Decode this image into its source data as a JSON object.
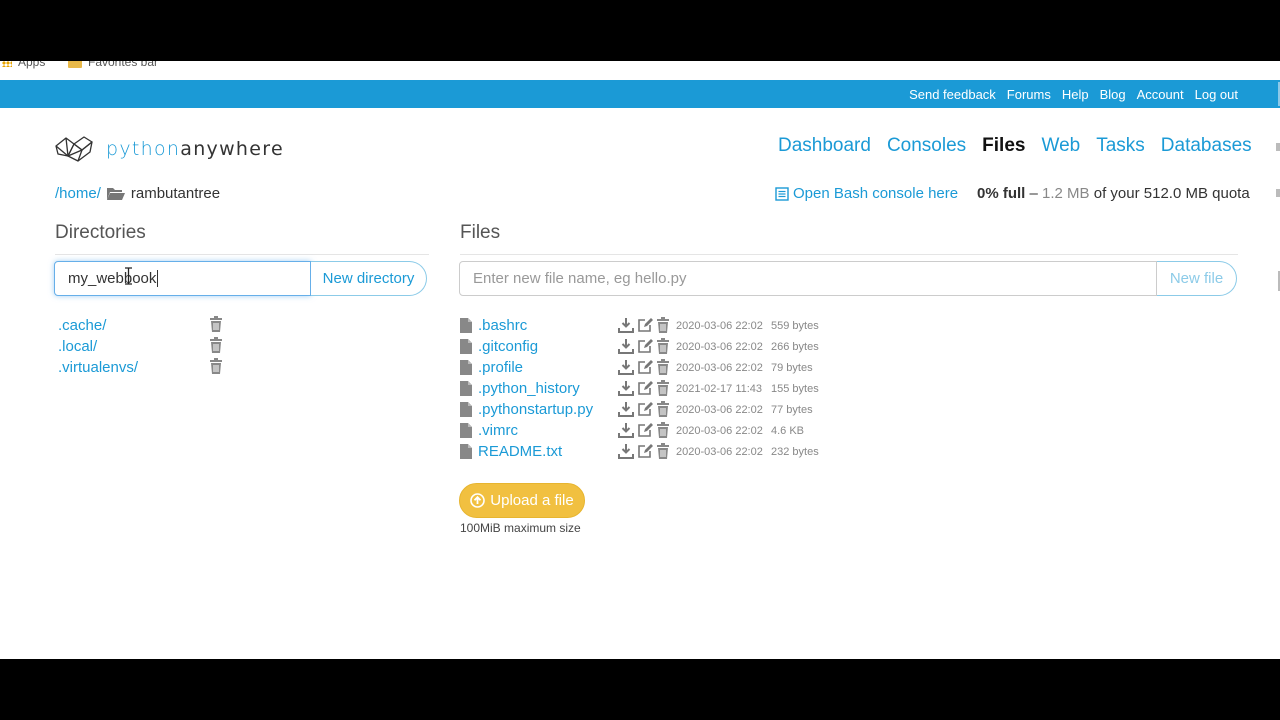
{
  "browser": {
    "bookmarks": [
      {
        "label": "Apps",
        "icon": "apps-grid-icon"
      },
      {
        "label": "Favorites bar",
        "icon": "folder-icon"
      }
    ]
  },
  "topbar": {
    "links": [
      "Send feedback",
      "Forums",
      "Help",
      "Blog",
      "Account",
      "Log out"
    ]
  },
  "brand": {
    "prefix": "python",
    "suffix": "anywhere"
  },
  "nav": {
    "items": [
      {
        "label": "Dashboard",
        "active": false
      },
      {
        "label": "Consoles",
        "active": false
      },
      {
        "label": "Files",
        "active": true
      },
      {
        "label": "Web",
        "active": false
      },
      {
        "label": "Tasks",
        "active": false
      },
      {
        "label": "Databases",
        "active": false
      }
    ]
  },
  "breadcrumb": {
    "root": "/home/",
    "current": "rambutantree"
  },
  "bash": {
    "label": "Open Bash console here"
  },
  "quota": {
    "percent": "0% full",
    "dash": "–",
    "used": "1.2 MB",
    "text": "of your 512.0 MB quota"
  },
  "directories": {
    "title": "Directories",
    "input_value": "my_webbook",
    "button": "New directory",
    "items": [
      ".cache/",
      ".local/",
      ".virtualenvs/"
    ]
  },
  "files": {
    "title": "Files",
    "input_placeholder": "Enter new file name, eg hello.py",
    "button": "New file",
    "items": [
      {
        "name": ".bashrc",
        "date": "2020-03-06 22:02",
        "size": "559 bytes"
      },
      {
        "name": ".gitconfig",
        "date": "2020-03-06 22:02",
        "size": "266 bytes"
      },
      {
        "name": ".profile",
        "date": "2020-03-06 22:02",
        "size": "79 bytes"
      },
      {
        "name": ".python_history",
        "date": "2021-02-17 11:43",
        "size": "155 bytes"
      },
      {
        "name": ".pythonstartup.py",
        "date": "2020-03-06 22:02",
        "size": "77 bytes"
      },
      {
        "name": ".vimrc",
        "date": "2020-03-06 22:02",
        "size": "4.6 KB"
      },
      {
        "name": "README.txt",
        "date": "2020-03-06 22:02",
        "size": "232 bytes"
      }
    ],
    "upload_label": "Upload a file",
    "upload_note": "100MiB maximum size"
  },
  "colors": {
    "accent": "#1b9ad6",
    "upload": "#f1c040",
    "text": "#333333"
  }
}
